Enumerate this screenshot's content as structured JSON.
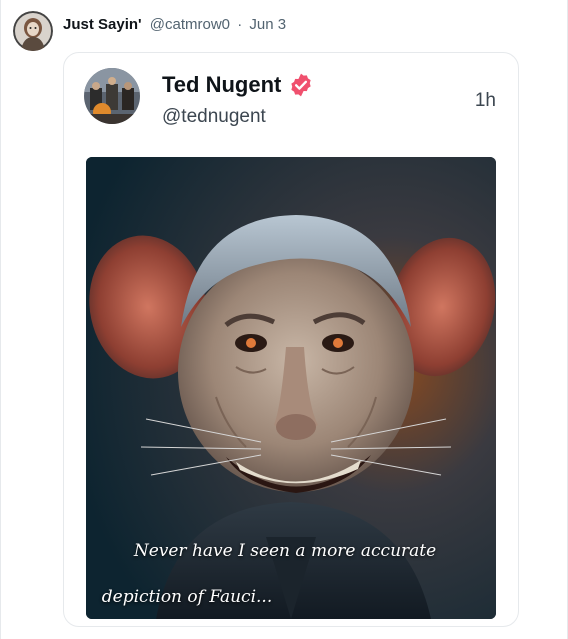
{
  "outer_post": {
    "display_name": "Just Sayin'",
    "handle": "@catmrow0",
    "separator": "·",
    "date": "Jun 3"
  },
  "quoted_post": {
    "display_name": "Ted Nugent",
    "handle": "@tednugent",
    "time": "1h",
    "verified": true,
    "verified_badge_color": "#f0506e",
    "image_caption_lines": [
      "Never have I seen a more accurate",
      "depiction of Fauci..."
    ]
  },
  "theme": {
    "text_primary": "#0f1419",
    "text_secondary": "#536471",
    "border": "#e6e9ec"
  }
}
